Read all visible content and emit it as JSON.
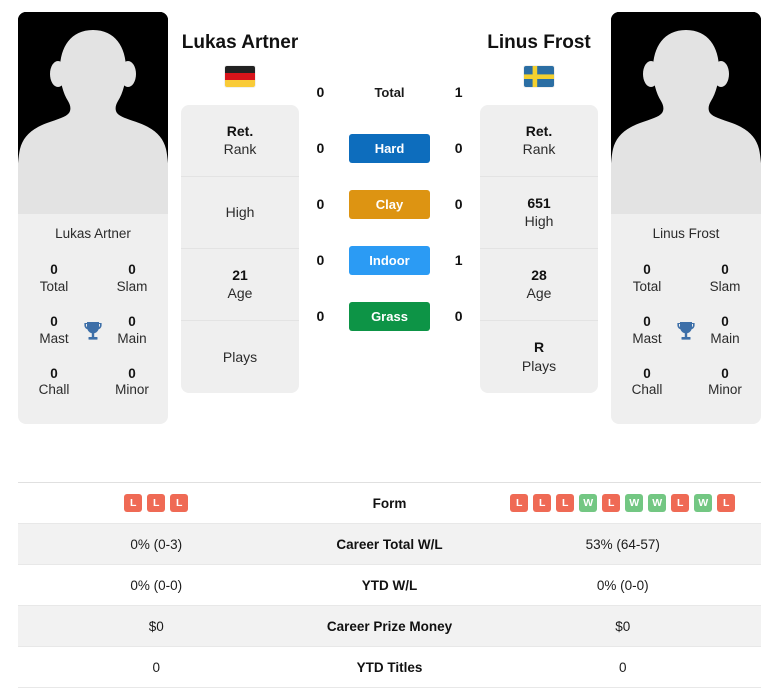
{
  "players": {
    "left": {
      "name": "Lukas Artner",
      "photo_caption": "Lukas Artner",
      "country": "Germany",
      "flag_icon": "flag-germany",
      "titles": {
        "total_value": "0",
        "total_label": "Total",
        "slam_value": "0",
        "slam_label": "Slam",
        "mast_value": "0",
        "mast_label": "Mast",
        "main_value": "0",
        "main_label": "Main",
        "chall_value": "0",
        "chall_label": "Chall",
        "minor_value": "0",
        "minor_label": "Minor",
        "trophy_icon": "trophy-icon"
      },
      "attributes": [
        {
          "value": "Ret.",
          "label": "Rank"
        },
        {
          "value": "",
          "label": "High"
        },
        {
          "value": "21",
          "label": "Age"
        },
        {
          "value": "",
          "label": "Plays"
        }
      ]
    },
    "right": {
      "name": "Linus Frost",
      "photo_caption": "Linus Frost",
      "country": "Sweden",
      "flag_icon": "flag-sweden",
      "titles": {
        "total_value": "0",
        "total_label": "Total",
        "slam_value": "0",
        "slam_label": "Slam",
        "mast_value": "0",
        "mast_label": "Mast",
        "main_value": "0",
        "main_label": "Main",
        "chall_value": "0",
        "chall_label": "Chall",
        "minor_value": "0",
        "minor_label": "Minor",
        "trophy_icon": "trophy-icon"
      },
      "attributes": [
        {
          "value": "Ret.",
          "label": "Rank"
        },
        {
          "value": "651",
          "label": "High"
        },
        {
          "value": "28",
          "label": "Age"
        },
        {
          "value": "R",
          "label": "Plays"
        }
      ]
    }
  },
  "head_to_head": {
    "rows": [
      {
        "left": "0",
        "label": "Total",
        "right": "1",
        "color": ""
      },
      {
        "left": "0",
        "label": "Hard",
        "right": "0",
        "color": "#0d6dbd"
      },
      {
        "left": "0",
        "label": "Clay",
        "right": "0",
        "color": "#dd9412"
      },
      {
        "left": "0",
        "label": "Indoor",
        "right": "1",
        "color": "#2b9bf4"
      },
      {
        "left": "0",
        "label": "Grass",
        "right": "0",
        "color": "#0d9446"
      }
    ]
  },
  "stats_table": {
    "rows": [
      {
        "label": "Form",
        "type": "form",
        "left_form": [
          "L",
          "L",
          "L"
        ],
        "right_form": [
          "L",
          "L",
          "L",
          "W",
          "L",
          "W",
          "W",
          "L",
          "W",
          "L"
        ]
      },
      {
        "label": "Career Total W/L",
        "type": "text",
        "left": "0% (0-3)",
        "right": "53% (64-57)"
      },
      {
        "label": "YTD W/L",
        "type": "text",
        "left": "0% (0-0)",
        "right": "0% (0-0)"
      },
      {
        "label": "Career Prize Money",
        "type": "text",
        "left": "$0",
        "right": "$0"
      },
      {
        "label": "YTD Titles",
        "type": "text",
        "left": "0",
        "right": "0"
      }
    ]
  },
  "colors": {
    "hard": "#0d6dbd",
    "clay": "#dd9412",
    "indoor": "#2b9bf4",
    "grass": "#0d9446",
    "win_badge": "#73c783",
    "loss_badge": "#ef6a55",
    "trophy": "#3d6fa8",
    "card_bg": "#efefef",
    "row_alt_bg": "#f2f2f2"
  }
}
